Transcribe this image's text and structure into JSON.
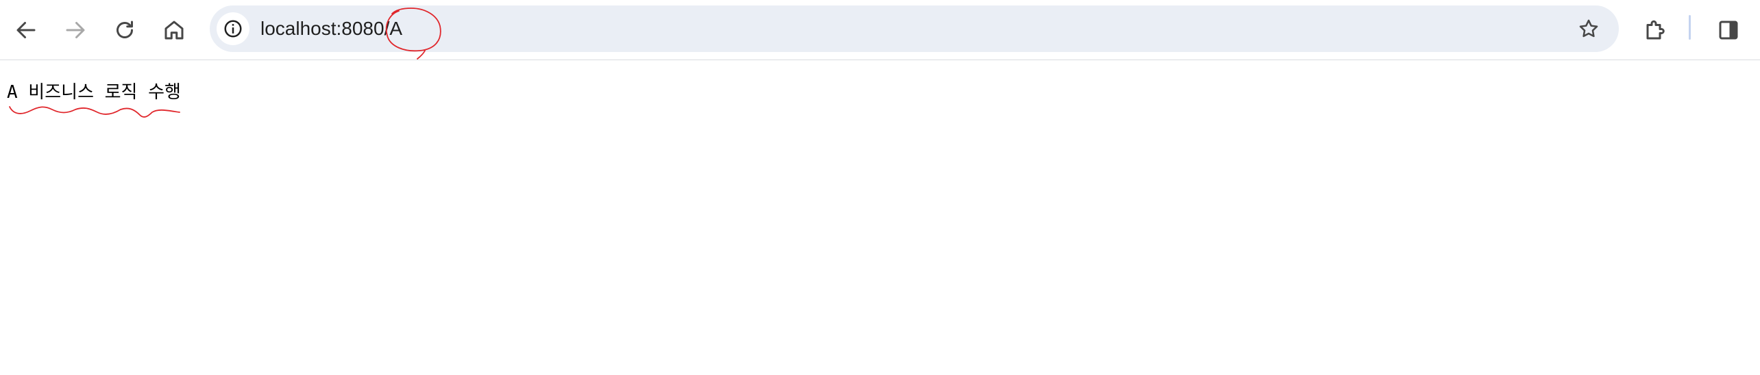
{
  "browser": {
    "address_bar": {
      "url": "localhost:8080/A",
      "icon": "info-circle-icon"
    },
    "icons": {
      "back": "arrow-left-icon",
      "forward": "arrow-right-icon",
      "reload": "reload-icon",
      "home": "home-icon",
      "bookmark": "star-icon",
      "extensions": "puzzle-icon",
      "side_panel": "side-panel-icon"
    },
    "forward_enabled": false
  },
  "page": {
    "body_text": "A 비즈니스 로직 수행"
  },
  "annotation": {
    "color": "#e0262b",
    "marks": [
      "circle-around-url-path",
      "wavy-underline-under-body-text"
    ]
  },
  "colors": {
    "omnibox_bg": "#eaeef5",
    "icon": "#474747",
    "icon_disabled": "#a8a8a8"
  }
}
